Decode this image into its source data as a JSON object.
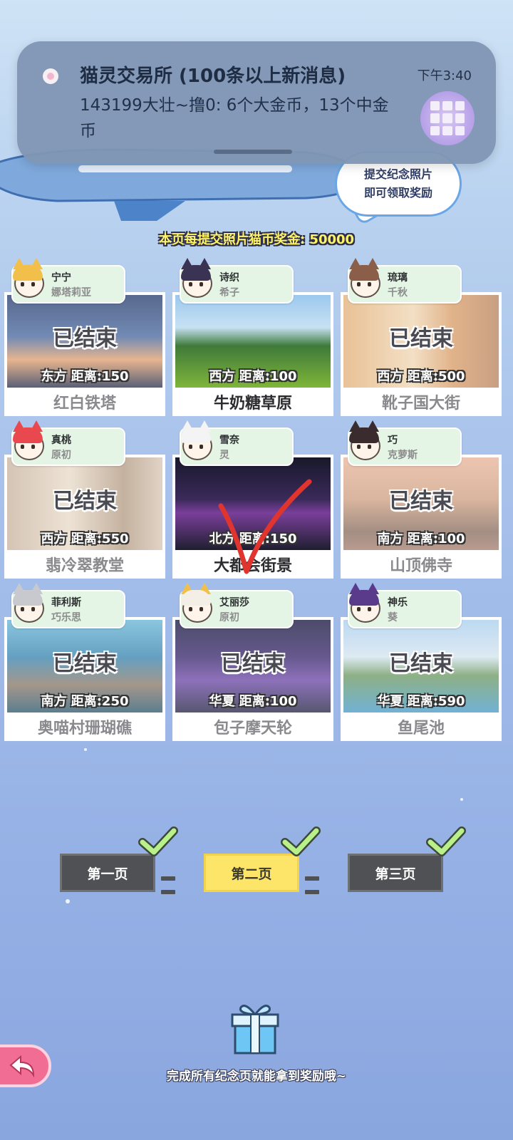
{
  "notification": {
    "app_name": "猫灵交易所",
    "title": "猫灵交易所 (100条以上新消息)",
    "time": "下午3:40",
    "body": "143199大壮~撸0: 6个大金币，13个中金币"
  },
  "hint_bubble": {
    "line1": "提交纪念照片",
    "line2": "即可领取奖励"
  },
  "bonus_text": "本页每提交照片猫币奖金: 50000",
  "cards": [
    {
      "char_name": "宁宁",
      "char_sub": "娜塔莉亚",
      "status": "已结束",
      "distance": "东方 距离:150",
      "location": "红白铁塔",
      "active": false
    },
    {
      "char_name": "诗织",
      "char_sub": "希子",
      "status": "",
      "distance": "西方 距离:100",
      "location": "牛奶糖草原",
      "active": true
    },
    {
      "char_name": "琉璃",
      "char_sub": "千秋",
      "status": "已结束",
      "distance": "西方 距离:500",
      "location": "靴子国大街",
      "active": false
    },
    {
      "char_name": "真桃",
      "char_sub": "原初",
      "status": "已结束",
      "distance": "西方 距离:550",
      "location": "翡冷翠教堂",
      "active": false
    },
    {
      "char_name": "雪奈",
      "char_sub": "灵",
      "status": "",
      "distance": "北方 距离:150",
      "location": "大都会街景",
      "active": true
    },
    {
      "char_name": "巧",
      "char_sub": "克萝斯",
      "status": "已结束",
      "distance": "南方 距离:100",
      "location": "山顶佛寺",
      "active": false
    },
    {
      "char_name": "菲利斯",
      "char_sub": "巧乐思",
      "status": "已结束",
      "distance": "南方 距离:250",
      "location": "奥喵村珊瑚礁",
      "active": false
    },
    {
      "char_name": "艾丽莎",
      "char_sub": "原初",
      "status": "已结束",
      "distance": "华夏 距离:100",
      "location": "包子摩天轮",
      "active": false
    },
    {
      "char_name": "神乐",
      "char_sub": "葵",
      "status": "已结束",
      "distance": "华夏 距离:590",
      "location": "鱼尾池",
      "active": false
    }
  ],
  "pages": [
    {
      "label": "第一页",
      "current": false,
      "completed": true
    },
    {
      "label": "第二页",
      "current": true,
      "completed": true
    },
    {
      "label": "第三页",
      "current": false,
      "completed": true
    }
  ],
  "gift_hint": "完成所有纪念页就能拿到奖励哦~",
  "icons": [
    "app-icon",
    "gift-icon",
    "back-arrow-icon",
    "checkmark-icon"
  ],
  "colors": {
    "accent_yellow": "#fde56a",
    "check_green": "#b9f08a",
    "back_pink": "#f26d94"
  }
}
